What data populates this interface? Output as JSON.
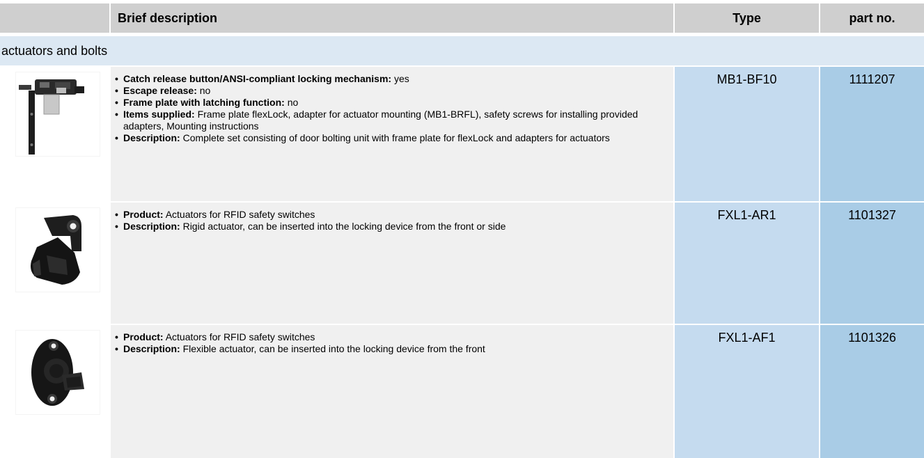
{
  "header": {
    "brief_description": "Brief description",
    "type": "Type",
    "part_no": "part no."
  },
  "category": {
    "label": "actuators and bolts"
  },
  "rows": [
    {
      "type": "MB1-BF10",
      "part_no": "1111207",
      "image_icon": "door-bolting-unit-icon",
      "bullets": [
        {
          "label": "Catch release button/ANSI-compliant locking mechanism:",
          "value": "yes"
        },
        {
          "label": "Escape release:",
          "value": "no"
        },
        {
          "label": "Frame plate with latching function:",
          "value": "no"
        },
        {
          "label": "Items supplied:",
          "value": "Frame plate flexLock, adapter for actuator mounting (MB1-BRFL), safety screws for installing provided adapters, Mounting instructions"
        },
        {
          "label": "Description:",
          "value": "Complete set consisting of door bolting unit with frame plate for flexLock and adapters for actuators"
        }
      ]
    },
    {
      "type": "FXL1-AR1",
      "part_no": "1101327",
      "image_icon": "rigid-actuator-icon",
      "bullets": [
        {
          "label": "Product:",
          "value": "Actuators for RFID safety switches"
        },
        {
          "label": "Description:",
          "value": "Rigid actuator, can be inserted into the locking device from the front or side"
        }
      ]
    },
    {
      "type": "FXL1-AF1",
      "part_no": "1101326",
      "image_icon": "flexible-actuator-icon",
      "bullets": [
        {
          "label": "Product:",
          "value": "Actuators for RFID safety switches"
        },
        {
          "label": "Description:",
          "value": "Flexible actuator, can be inserted into the locking device from the front"
        }
      ]
    }
  ]
}
